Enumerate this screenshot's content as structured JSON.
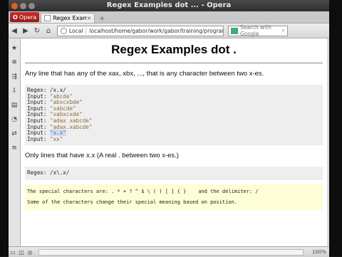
{
  "window": {
    "title": "Regex Examples dot ... - Opera"
  },
  "browser": {
    "menu_button": "Opera",
    "tab_label": "Regex Examples ...",
    "new_tab_symbol": "+",
    "address_scheme_label": "Local",
    "address_url": "localhost/home/gabor/work/gabor/training/programming_pe",
    "search_placeholder": "Search with Google",
    "zoom": "100%"
  },
  "page": {
    "heading": "Regex Examples dot .",
    "intro": "Any line that has any of the xax, xbx, ..., that is any character between two x-es.",
    "example1": {
      "lines": [
        {
          "label": "Regex: ",
          "value": "/x.x/",
          "quoted": false
        },
        {
          "label": "Input: ",
          "value": "\"abcde\"",
          "quoted": true
        },
        {
          "label": "Input: ",
          "value": "\"abxcxbde\"",
          "quoted": true
        },
        {
          "label": "Input: ",
          "value": "\"xabcde\"",
          "quoted": true
        },
        {
          "label": "Input: ",
          "value": "\"xabxcxde\"",
          "quoted": true
        },
        {
          "label": "Input: ",
          "value": "\"adax xabcde\"",
          "quoted": true
        },
        {
          "label": "Input: ",
          "value": "\"adax.xabcde\"",
          "quoted": true
        },
        {
          "label": "Input: ",
          "value": "\"x.x\"",
          "quoted": true
        },
        {
          "label": "Input: ",
          "value": "\"xx\"",
          "quoted": true
        }
      ]
    },
    "middle_text": "Only lines that have x.x (A real . between two x-es.)",
    "example2": {
      "label": "Regex: ",
      "value": "/x\\.x/"
    },
    "note": {
      "line1": "The special characters are: . * + ? ^ $ \\ ( ) [ ] { }    and the delimiter: /",
      "line2": "Some of the characters change their special meaning based on position."
    }
  }
}
